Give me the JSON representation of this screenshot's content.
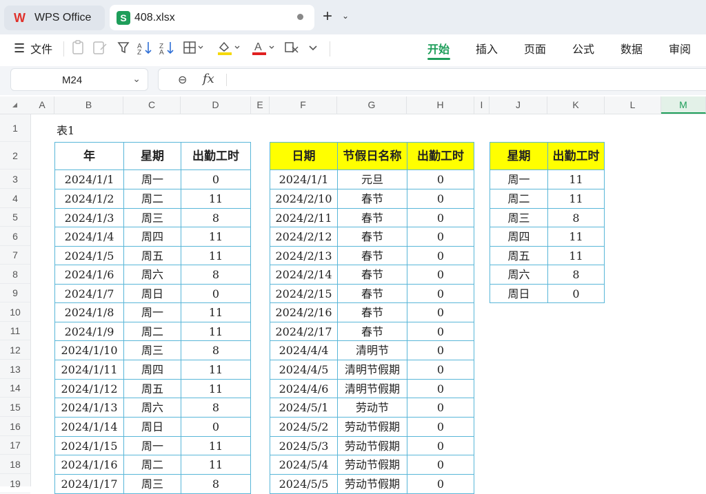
{
  "app": {
    "home_tab": "WPS Office",
    "file_tab": "408.xlsx"
  },
  "toolbar": {
    "menu_label": "文件",
    "ribbon_tabs": [
      "开始",
      "插入",
      "页面",
      "公式",
      "数据",
      "审阅"
    ],
    "active_tab": "开始"
  },
  "formula_bar": {
    "cell_ref": "M24",
    "fx_label": "fx",
    "value": ""
  },
  "sheet": {
    "columns": [
      "A",
      "B",
      "C",
      "D",
      "E",
      "F",
      "G",
      "H",
      "I",
      "J",
      "K",
      "L",
      "M"
    ],
    "selected_column": "M",
    "rows": [
      "1",
      "2",
      "3",
      "4",
      "5",
      "6",
      "7",
      "8",
      "9",
      "10",
      "11",
      "12",
      "13",
      "14",
      "15",
      "16",
      "17",
      "18",
      "19"
    ],
    "caption": "表1",
    "colors": {
      "header_fill": "#ffff00",
      "border": "#58b6d8",
      "accent": "#1e9e5a"
    },
    "table1": {
      "headers": [
        "年",
        "星期",
        "出勤工时"
      ],
      "rows": [
        [
          "2024/1/1",
          "周一",
          "0"
        ],
        [
          "2024/1/2",
          "周二",
          "11"
        ],
        [
          "2024/1/3",
          "周三",
          "8"
        ],
        [
          "2024/1/4",
          "周四",
          "11"
        ],
        [
          "2024/1/5",
          "周五",
          "11"
        ],
        [
          "2024/1/6",
          "周六",
          "8"
        ],
        [
          "2024/1/7",
          "周日",
          "0"
        ],
        [
          "2024/1/8",
          "周一",
          "11"
        ],
        [
          "2024/1/9",
          "周二",
          "11"
        ],
        [
          "2024/1/10",
          "周三",
          "8"
        ],
        [
          "2024/1/11",
          "周四",
          "11"
        ],
        [
          "2024/1/12",
          "周五",
          "11"
        ],
        [
          "2024/1/13",
          "周六",
          "8"
        ],
        [
          "2024/1/14",
          "周日",
          "0"
        ],
        [
          "2024/1/15",
          "周一",
          "11"
        ],
        [
          "2024/1/16",
          "周二",
          "11"
        ],
        [
          "2024/1/17",
          "周三",
          "8"
        ]
      ]
    },
    "table2": {
      "headers": [
        "日期",
        "节假日名称",
        "出勤工时"
      ],
      "rows": [
        [
          "2024/1/1",
          "元旦",
          "0"
        ],
        [
          "2024/2/10",
          "春节",
          "0"
        ],
        [
          "2024/2/11",
          "春节",
          "0"
        ],
        [
          "2024/2/12",
          "春节",
          "0"
        ],
        [
          "2024/2/13",
          "春节",
          "0"
        ],
        [
          "2024/2/14",
          "春节",
          "0"
        ],
        [
          "2024/2/15",
          "春节",
          "0"
        ],
        [
          "2024/2/16",
          "春节",
          "0"
        ],
        [
          "2024/2/17",
          "春节",
          "0"
        ],
        [
          "2024/4/4",
          "清明节",
          "0"
        ],
        [
          "2024/4/5",
          "清明节假期",
          "0"
        ],
        [
          "2024/4/6",
          "清明节假期",
          "0"
        ],
        [
          "2024/5/1",
          "劳动节",
          "0"
        ],
        [
          "2024/5/2",
          "劳动节假期",
          "0"
        ],
        [
          "2024/5/3",
          "劳动节假期",
          "0"
        ],
        [
          "2024/5/4",
          "劳动节假期",
          "0"
        ],
        [
          "2024/5/5",
          "劳动节假期",
          "0"
        ]
      ]
    },
    "table3": {
      "headers": [
        "星期",
        "出勤工时"
      ],
      "rows": [
        [
          "周一",
          "11"
        ],
        [
          "周二",
          "11"
        ],
        [
          "周三",
          "8"
        ],
        [
          "周四",
          "11"
        ],
        [
          "周五",
          "11"
        ],
        [
          "周六",
          "8"
        ],
        [
          "周日",
          "0"
        ]
      ]
    }
  }
}
